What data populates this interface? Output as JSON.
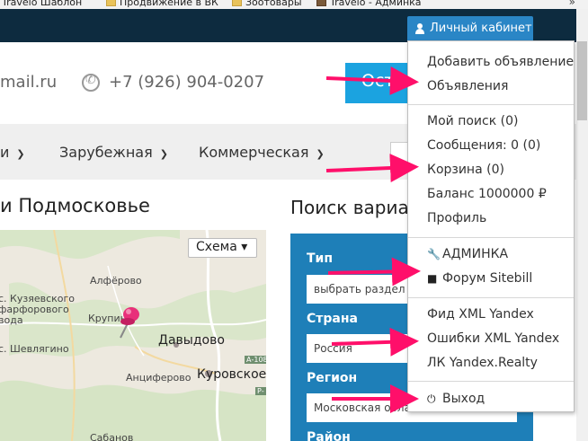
{
  "bookmarks": {
    "items": [
      {
        "label": "Travelo Шаблон",
        "icon": "favicon"
      },
      {
        "label": "Продвижение в ВК",
        "icon": "folder-icon"
      },
      {
        "label": "Зоотовары",
        "icon": "folder-icon"
      },
      {
        "label": "Travelo - Админка",
        "icon": "favicon"
      }
    ],
    "more": "»"
  },
  "topbar": {
    "cabinet_label": "Личный кабинет"
  },
  "header": {
    "email_fragment": "mail.ru",
    "phone": "+7 (926) 904-0207",
    "post_button_fragment": "Оста"
  },
  "categories": [
    {
      "label": "и"
    },
    {
      "label": "Зарубежная"
    },
    {
      "label": "Коммерческая"
    }
  ],
  "titles": {
    "region": "и Подмосковье",
    "search": "Поиск вариа"
  },
  "map": {
    "scheme_label": "Схема ▾",
    "labels": {
      "alferovo": "Алфёрово",
      "kuzyaevsky": "с. Кузяевского",
      "farforovo": "фарфорового",
      "zavoda": "вода",
      "krupin": "Крупин",
      "shevlyagino": "с. Шевлягино",
      "davydovo": "Давыдово",
      "kurovskoe": "Куровское",
      "anciferovo": "Анциферово",
      "sabanovo": "Сабанов"
    },
    "roads": [
      "А-108",
      "Р-"
    ]
  },
  "search_panel": {
    "type_label": "Тип",
    "type_value": "выбрать раздел",
    "country_label": "Страна",
    "country_value": "Россия",
    "region_label": "Регион",
    "region_value": "Московская обла",
    "district_label": "Район"
  },
  "dropdown": {
    "group1": [
      "Добавить объявление",
      "Объявления"
    ],
    "group2": [
      "Мой поиск (0)",
      "Сообщения: 0 (0)",
      "Корзина (0)",
      "Баланс 1000000 ₽",
      "Профиль"
    ],
    "admin": {
      "label": "АДМИНКА",
      "icon": "wrench-icon"
    },
    "forum": {
      "label": "Форум Sitebill",
      "icon": "chat-icon"
    },
    "group4": [
      "Фид XML Yandex",
      "Ошибки XML Yandex",
      "ЛК Yandex.Realty"
    ],
    "logout": {
      "label": "Выход",
      "icon": "power-icon"
    }
  },
  "colors": {
    "topbar": "#0d2b3f",
    "accent": "#2a86c6",
    "search_panel": "#1e7fb8",
    "arrow": "#ff0f6a"
  }
}
